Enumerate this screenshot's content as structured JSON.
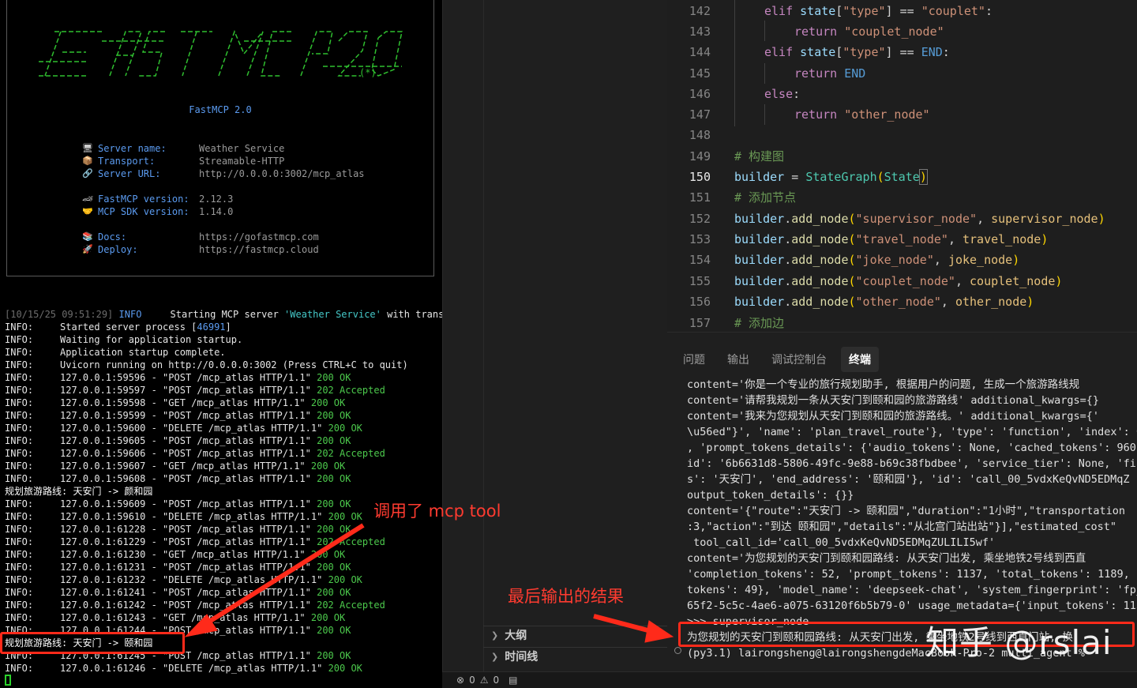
{
  "banner": {
    "title": "FastMCP  2.0",
    "rows": [
      {
        "icon": "computer-icon",
        "glyph": "🖥",
        "key": "Server name:",
        "value": "Weather Service"
      },
      {
        "icon": "package-icon",
        "glyph": "📦",
        "key": "Transport:",
        "value": "Streamable-HTTP"
      },
      {
        "icon": "link-icon",
        "glyph": "🔗",
        "key": "Server URL:",
        "value": "http://0.0.0.0:3002/mcp_atlas"
      },
      {
        "icon": "race-car-icon",
        "glyph": "🏎",
        "key": "FastMCP version:",
        "value": "2.12.3"
      },
      {
        "icon": "handshake-icon",
        "glyph": "🤝",
        "key": "MCP SDK version:",
        "value": "1.14.0"
      },
      {
        "icon": "books-icon",
        "glyph": "📚",
        "key": "Docs:",
        "value": "https://gofastmcp.com"
      },
      {
        "icon": "rocket-icon",
        "glyph": "🚀",
        "key": "Deploy:",
        "value": "https://fastmcp.cloud"
      }
    ]
  },
  "log": {
    "first_ts": "[10/15/25 09:51:29]",
    "first_level": "INFO",
    "first_msg_a": "     Starting MCP server ",
    "first_msg_name": "'Weather Service'",
    "first_msg_b": " with transpo",
    "lines": [
      {
        "lvl": "INFO:",
        "a": "Started server process [",
        "num": "46991",
        "b": "]",
        "c": ""
      },
      {
        "lvl": "INFO:",
        "a": "Waiting for application startup.",
        "num": "",
        "b": "",
        "c": ""
      },
      {
        "lvl": "INFO:",
        "a": "Application startup complete.",
        "num": "",
        "b": "",
        "c": ""
      },
      {
        "lvl": "INFO:",
        "a": "Uvicorn running on http://0.0.0.0:3002 (Press CTRL+C to quit)",
        "num": "",
        "b": "",
        "c": ""
      },
      {
        "lvl": "INFO:",
        "a": "127.0.0.1:59596 - \"POST /mcp_atlas HTTP/1.1\" ",
        "num": "",
        "b": "",
        "c": "200 OK"
      },
      {
        "lvl": "INFO:",
        "a": "127.0.0.1:59597 - \"POST /mcp_atlas HTTP/1.1\" ",
        "num": "",
        "b": "",
        "c": "202 Accepted"
      },
      {
        "lvl": "INFO:",
        "a": "127.0.0.1:59598 - \"GET /mcp_atlas HTTP/1.1\" ",
        "num": "",
        "b": "",
        "c": "200 OK"
      },
      {
        "lvl": "INFO:",
        "a": "127.0.0.1:59599 - \"POST /mcp_atlas HTTP/1.1\" ",
        "num": "",
        "b": "",
        "c": "200 OK"
      },
      {
        "lvl": "INFO:",
        "a": "127.0.0.1:59600 - \"DELETE /mcp_atlas HTTP/1.1\" ",
        "num": "",
        "b": "",
        "c": "200 OK"
      },
      {
        "lvl": "INFO:",
        "a": "127.0.0.1:59605 - \"POST /mcp_atlas HTTP/1.1\" ",
        "num": "",
        "b": "",
        "c": "200 OK"
      },
      {
        "lvl": "INFO:",
        "a": "127.0.0.1:59606 - \"POST /mcp_atlas HTTP/1.1\" ",
        "num": "",
        "b": "",
        "c": "202 Accepted"
      },
      {
        "lvl": "INFO:",
        "a": "127.0.0.1:59607 - \"GET /mcp_atlas HTTP/1.1\" ",
        "num": "",
        "b": "",
        "c": "200 OK"
      },
      {
        "lvl": "INFO:",
        "a": "127.0.0.1:59608 - \"POST /mcp_atlas HTTP/1.1\" ",
        "num": "",
        "b": "",
        "c": "200 OK"
      },
      {
        "lvl": "",
        "a": "规划旅游路线: 天安门 -> 颜和园",
        "num": "",
        "b": "",
        "c": ""
      },
      {
        "lvl": "INFO:",
        "a": "127.0.0.1:59609 - \"POST /mcp_atlas HTTP/1.1\" ",
        "num": "",
        "b": "",
        "c": "200 OK"
      },
      {
        "lvl": "INFO:",
        "a": "127.0.0.1:59610 - \"DELETE /mcp_atlas HTTP/1.1\" ",
        "num": "",
        "b": "",
        "c": "200 OK"
      },
      {
        "lvl": "INFO:",
        "a": "127.0.0.1:61228 - \"POST /mcp_atlas HTTP/1.1\" ",
        "num": "",
        "b": "",
        "c": "200 OK"
      },
      {
        "lvl": "INFO:",
        "a": "127.0.0.1:61229 - \"POST /mcp_atlas HTTP/1.1\" ",
        "num": "",
        "b": "",
        "c": "202 Accepted"
      },
      {
        "lvl": "INFO:",
        "a": "127.0.0.1:61230 - \"GET /mcp_atlas HTTP/1.1\" ",
        "num": "",
        "b": "",
        "c": "200 OK"
      },
      {
        "lvl": "INFO:",
        "a": "127.0.0.1:61231 - \"POST /mcp_atlas HTTP/1.1\" ",
        "num": "",
        "b": "",
        "c": "200 OK"
      },
      {
        "lvl": "INFO:",
        "a": "127.0.0.1:61232 - \"DELETE /mcp_atlas HTTP/1.1\" ",
        "num": "",
        "b": "",
        "c": "200 OK"
      },
      {
        "lvl": "INFO:",
        "a": "127.0.0.1:61241 - \"POST /mcp_atlas HTTP/1.1\" ",
        "num": "",
        "b": "",
        "c": "200 OK"
      },
      {
        "lvl": "INFO:",
        "a": "127.0.0.1:61242 - \"POST /mcp_atlas HTTP/1.1\" ",
        "num": "",
        "b": "",
        "c": "202 Accepted"
      },
      {
        "lvl": "INFO:",
        "a": "127.0.0.1:61243 - \"GET /mcp_atlas HTTP/1.1\" ",
        "num": "",
        "b": "",
        "c": "200 OK"
      },
      {
        "lvl": "INFO:",
        "a": "127.0.0.1:61244 - \"POST /mcp_atlas HTTP/1.1\" ",
        "num": "",
        "b": "",
        "c": "200 OK"
      },
      {
        "lvl": "",
        "a": "规划旅游路线: 天安门 -> 颐和园",
        "num": "",
        "b": "",
        "c": ""
      },
      {
        "lvl": "INFO:",
        "a": "127.0.0.1:61245 - \"POST /mcp_atlas HTTP/1.1\" ",
        "num": "",
        "b": "",
        "c": "200 OK"
      },
      {
        "lvl": "INFO:",
        "a": "127.0.0.1:61246 - \"DELETE /mcp_atlas HTTP/1.1\" ",
        "num": "",
        "b": "",
        "c": "200 OK"
      }
    ]
  },
  "editor": {
    "current_line": "150"
  },
  "panel": {
    "tabs": [
      "问题",
      "输出",
      "调试控制台",
      "终端"
    ],
    "active_tab": "终端",
    "lines": [
      "content='你是一个专业的旅行规划助手, 根据用户的问题, 生成一个旅游路线规",
      "content='请帮我规划一条从天安门到颐和园的旅游路线' additional_kwargs={}",
      "content='我来为您规划从天安门到颐和园的旅游路线。' additional_kwargs={'",
      "\\u56ed\"}', 'name': 'plan_travel_route'}, 'type': 'function', 'index': 0",
      ", 'prompt_tokens_details': {'audio_tokens': None, 'cached_tokens': 960}",
      "id': '6b6631d8-5806-49fc-9e88-b69c38fbdbee', 'service_tier': None, 'fin",
      "s': '天安门', 'end_address': '颐和园'}, 'id': 'call_00_5vdxKeQvND5EDMqZ",
      "output_token_details': {}}",
      "content='{\"route\":\"天安门 -> 颐和园\",\"duration\":\"1小时\",\"transportation",
      ":3,\"action\":\"到达 颐和园\",\"details\":\"从北宫门站出站\"}],\"estimated_cost\"",
      " tool_call_id='call_00_5vdxKeQvND5EDMqZULILI5wf'",
      "content='为您规划的天安门到颐和园路线: 从天安门出发, 乘坐地铁2号线到西直",
      "'completion_tokens': 52, 'prompt_tokens': 1137, 'total_tokens': 1189, '",
      "tokens': 49}, 'model_name': 'deepseek-chat', 'system_fingerprint': 'fp_",
      "65f2-5c5c-4ae6-a075-63120f6b5b79-0' usage_metadata={'input_tokens': 113",
      ">>> supervisor_node",
      "为您规划的天安门到颐和园路线: 从天安门出发, 乘坐地铁2号线到西直门站, 换",
      "(py3.1) lairongsheng@lairongshengdeMacBook-Pro-2 multi_agent % "
    ]
  },
  "outline": {
    "items": [
      "大纲",
      "时间线"
    ]
  },
  "statusbar": {
    "errors": "0",
    "warnings": "0"
  },
  "annotations": {
    "tool_call": "调用了 mcp tool",
    "final_output": "最后输出的结果",
    "watermark": "知乎 @rslai"
  }
}
